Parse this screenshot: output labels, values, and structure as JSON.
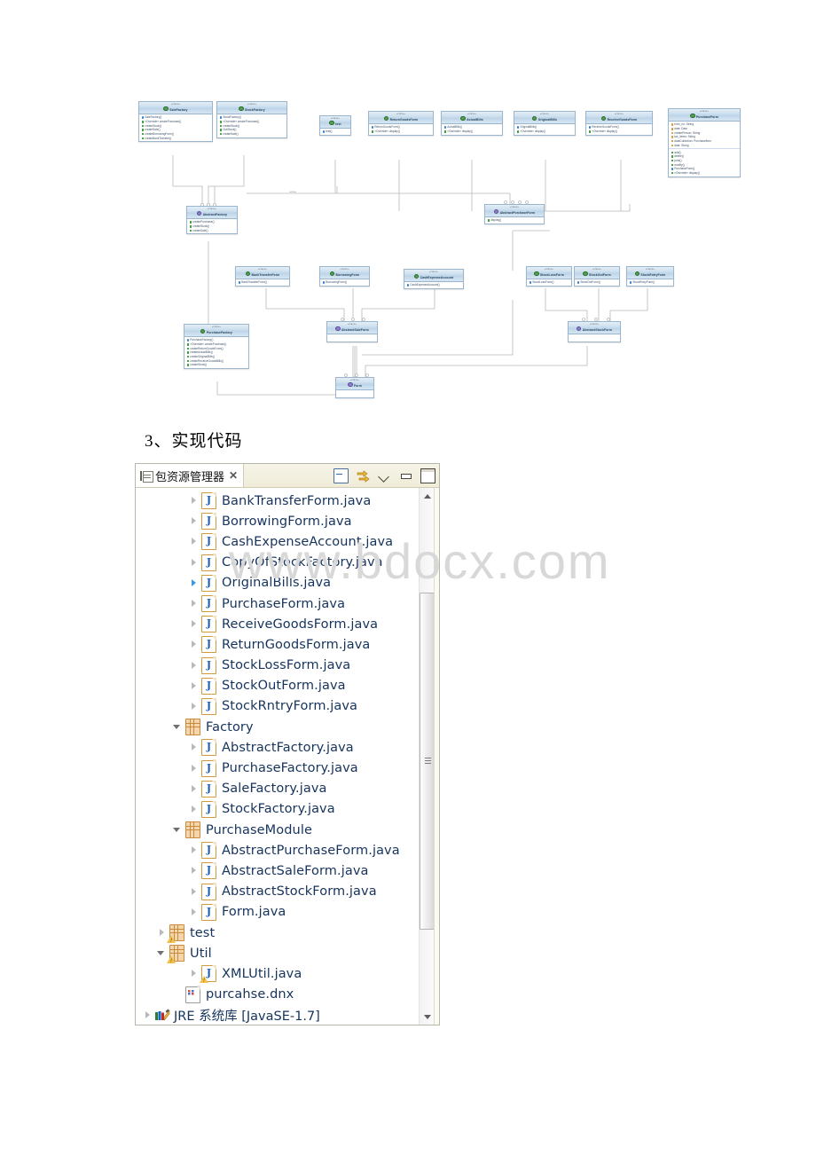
{
  "document": {
    "heading": "3、实现代码",
    "watermark": "www.bdocx.com"
  },
  "uml_diagram": {
    "classes": [
      {
        "id": "SaleFactory",
        "stereotype": "«class»",
        "name": "SaleFactory",
        "members": [
          "SaleFactory()",
          "«Override» createPurchase()",
          "createStock()",
          "createSale()",
          "createBorrowingForm()",
          "createBankTransfer()"
        ]
      },
      {
        "id": "StockFactory",
        "stereotype": "«class»",
        "name": "StockFactory",
        "members": [
          "StockFactory()",
          "«Override» createPurchase()",
          "createStock()",
          "OutStock()",
          "createSale()"
        ]
      },
      {
        "id": "test",
        "stereotype": "«class»",
        "name": "test",
        "members": [
          "test()"
        ]
      },
      {
        "id": "ReturnGoodsForm",
        "stereotype": "«class»",
        "name": "ReturnGoodsForm",
        "members": [
          "ReturnGoodsForm()",
          "«Override» display()"
        ]
      },
      {
        "id": "ActualBills",
        "stereotype": "«class»",
        "name": "ActualBills",
        "members": [
          "ActualBills()",
          "«Override» display()"
        ]
      },
      {
        "id": "OriginalBills",
        "stereotype": "«class»",
        "name": "OriginalBills",
        "members": [
          "OriginalBills()",
          "«Override» display()"
        ]
      },
      {
        "id": "ReceiveGoodsForm",
        "stereotype": "«class»",
        "name": "ReceiveGoodsForm",
        "members": [
          "ReceiveGoodsForm()",
          "«Override» display()"
        ]
      },
      {
        "id": "PurchaseForm",
        "stereotype": "«class»",
        "name": "PurchaseForm",
        "fields": [
          "form_no: String",
          "date: Date",
          "createPerson: String",
          "tax_items: String",
          "dataCollection: PurchaseItem",
          "date: String"
        ],
        "members": [
          "add()",
          "delete()",
          "print()",
          "modify()",
          "PurchaseForm()",
          "«Override» display()"
        ]
      },
      {
        "id": "AbstractFactory",
        "stereotype": "«class»",
        "name": "AbstractFactory",
        "abstract": true,
        "members": [
          "createPurchase()",
          "createStock()",
          "createSale()"
        ]
      },
      {
        "id": "AbstractPurchaseForm",
        "stereotype": "«class»",
        "name": "AbstractPurchaseForm",
        "abstract": true,
        "members": [
          "display()"
        ]
      },
      {
        "id": "BankTransferForm",
        "stereotype": "«class»",
        "name": "BankTransferForm",
        "members": [
          "BankTransferForm()"
        ]
      },
      {
        "id": "BorrowingForm",
        "stereotype": "«class»",
        "name": "BorrowingForm",
        "members": [
          "BorrowingForm()"
        ]
      },
      {
        "id": "CashExpenseAccount",
        "stereotype": "«class»",
        "name": "CashExpenseAccount",
        "members": [
          "CashExpenseAccount()"
        ]
      },
      {
        "id": "StockLossForm",
        "stereotype": "«class»",
        "name": "StockLossForm",
        "members": [
          "StockLossForm()"
        ]
      },
      {
        "id": "StockOutForm",
        "stereotype": "«class»",
        "name": "StockOutForm",
        "members": [
          "StockOutForm()"
        ]
      },
      {
        "id": "StockRntryForm",
        "stereotype": "«class»",
        "name": "StockRntryForm",
        "members": [
          "StockRntryForm()"
        ]
      },
      {
        "id": "PurchaseFactory",
        "stereotype": "«class»",
        "name": "PurchaseFactory",
        "members": [
          "PurchaseFactory()",
          "«Override» createPurchase()",
          "createReturnGoodsForm()",
          "createActualBills()",
          "createOriginalBills()",
          "createReceiveGoodsBills()",
          "createStock()"
        ]
      },
      {
        "id": "AbstractSaleForm",
        "stereotype": "«class»",
        "name": "AbstractSaleForm",
        "abstract": true,
        "members": []
      },
      {
        "id": "AbstractStockForm",
        "stereotype": "«class»",
        "name": "AbstractStockForm",
        "abstract": true,
        "members": []
      },
      {
        "id": "Form",
        "stereotype": "«class»",
        "name": "Form",
        "abstract": true,
        "members": []
      }
    ],
    "edge_labels": [
      "use",
      "use"
    ]
  },
  "eclipse_view": {
    "tab": {
      "label": "包资源管理器",
      "icon": "package-explorer-icon",
      "close": "✕"
    },
    "toolbar": [
      {
        "name": "collapse-all-icon",
        "title": "Collapse All"
      },
      {
        "name": "link-with-editor-icon",
        "title": "Link with Editor"
      },
      {
        "name": "view-menu-chevron-icon",
        "title": "View Menu"
      },
      {
        "name": "minimize-icon",
        "title": "Minimize"
      },
      {
        "name": "maximize-icon",
        "title": "Maximize"
      }
    ],
    "tree": [
      {
        "label": "BankTransferForm.java",
        "icon": "java-file-icon",
        "indent": 2,
        "arrow": "closed"
      },
      {
        "label": "BorrowingForm.java",
        "icon": "java-file-icon",
        "indent": 2,
        "arrow": "closed"
      },
      {
        "label": "CashExpenseAccount.java",
        "icon": "java-file-icon",
        "indent": 2,
        "arrow": "closed"
      },
      {
        "label": "CopyOfStockFactory.java",
        "icon": "java-file-icon",
        "indent": 2,
        "arrow": "closed"
      },
      {
        "label": "OriginalBills.java",
        "icon": "java-file-icon",
        "indent": 2,
        "arrow": "closed-highlight"
      },
      {
        "label": "PurchaseForm.java",
        "icon": "java-file-icon",
        "indent": 2,
        "arrow": "closed"
      },
      {
        "label": "ReceiveGoodsForm.java",
        "icon": "java-file-icon",
        "indent": 2,
        "arrow": "closed"
      },
      {
        "label": "ReturnGoodsForm.java",
        "icon": "java-file-icon",
        "indent": 2,
        "arrow": "closed"
      },
      {
        "label": "StockLossForm.java",
        "icon": "java-file-icon",
        "indent": 2,
        "arrow": "closed"
      },
      {
        "label": "StockOutForm.java",
        "icon": "java-file-icon",
        "indent": 2,
        "arrow": "closed"
      },
      {
        "label": "StockRntryForm.java",
        "icon": "java-file-icon",
        "indent": 2,
        "arrow": "closed"
      },
      {
        "label": "Factory",
        "icon": "package-icon",
        "indent": 1,
        "arrow": "open"
      },
      {
        "label": "AbstractFactory.java",
        "icon": "java-file-icon",
        "indent": 2,
        "arrow": "closed"
      },
      {
        "label": "PurchaseFactory.java",
        "icon": "java-file-icon",
        "indent": 2,
        "arrow": "closed"
      },
      {
        "label": "SaleFactory.java",
        "icon": "java-file-icon",
        "indent": 2,
        "arrow": "closed"
      },
      {
        "label": "StockFactory.java",
        "icon": "java-file-icon",
        "indent": 2,
        "arrow": "closed"
      },
      {
        "label": "PurchaseModule",
        "icon": "package-icon",
        "indent": 1,
        "arrow": "open"
      },
      {
        "label": "AbstractPurchaseForm.java",
        "icon": "java-file-icon",
        "indent": 2,
        "arrow": "closed"
      },
      {
        "label": "AbstractSaleForm.java",
        "icon": "java-file-icon",
        "indent": 2,
        "arrow": "closed"
      },
      {
        "label": "AbstractStockForm.java",
        "icon": "java-file-icon",
        "indent": 2,
        "arrow": "closed"
      },
      {
        "label": "Form.java",
        "icon": "java-file-icon",
        "indent": 2,
        "arrow": "closed"
      },
      {
        "label": "test",
        "icon": "package-icon-warning",
        "indent": 0,
        "arrow": "closed"
      },
      {
        "label": "Util",
        "icon": "package-icon-warning",
        "indent": 0,
        "arrow": "open"
      },
      {
        "label": "XMLUtil.java",
        "icon": "java-file-icon-warning",
        "indent": 2,
        "arrow": "closed"
      },
      {
        "label": "purcahse.dnx",
        "icon": "dnx-file-icon",
        "indent": 1,
        "arrow": "none"
      },
      {
        "label": "JRE 系统库 [JavaSE-1.7]",
        "icon": "jre-library-icon",
        "indent": 0,
        "arrow": "closed",
        "library": true
      }
    ],
    "scrollbar": {
      "up_arrow": "scroll-up-arrow",
      "down_arrow": "scroll-down-arrow",
      "thumb": "scroll-thumb"
    }
  }
}
